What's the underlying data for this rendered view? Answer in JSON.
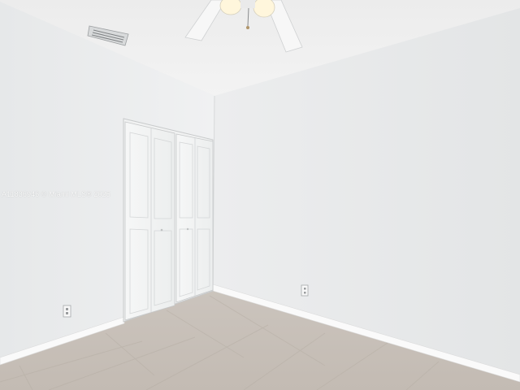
{
  "watermark": {
    "text": "A11836946 © Miami MLS® 2025"
  },
  "colors": {
    "ceiling": "#efefef",
    "left_wall": "#eceeef",
    "right_wall": "#e8eaeb",
    "floor": "#c9c2bb",
    "baseboard": "#fbfbfb",
    "door": "#f4f5f5"
  },
  "objects": {
    "fan": "ceiling-fan-with-light",
    "vent": "ceiling-air-vent",
    "closet": "bifold-closet-doors",
    "outlets": "wall-electrical-outlets",
    "floor": "tile-floor"
  }
}
